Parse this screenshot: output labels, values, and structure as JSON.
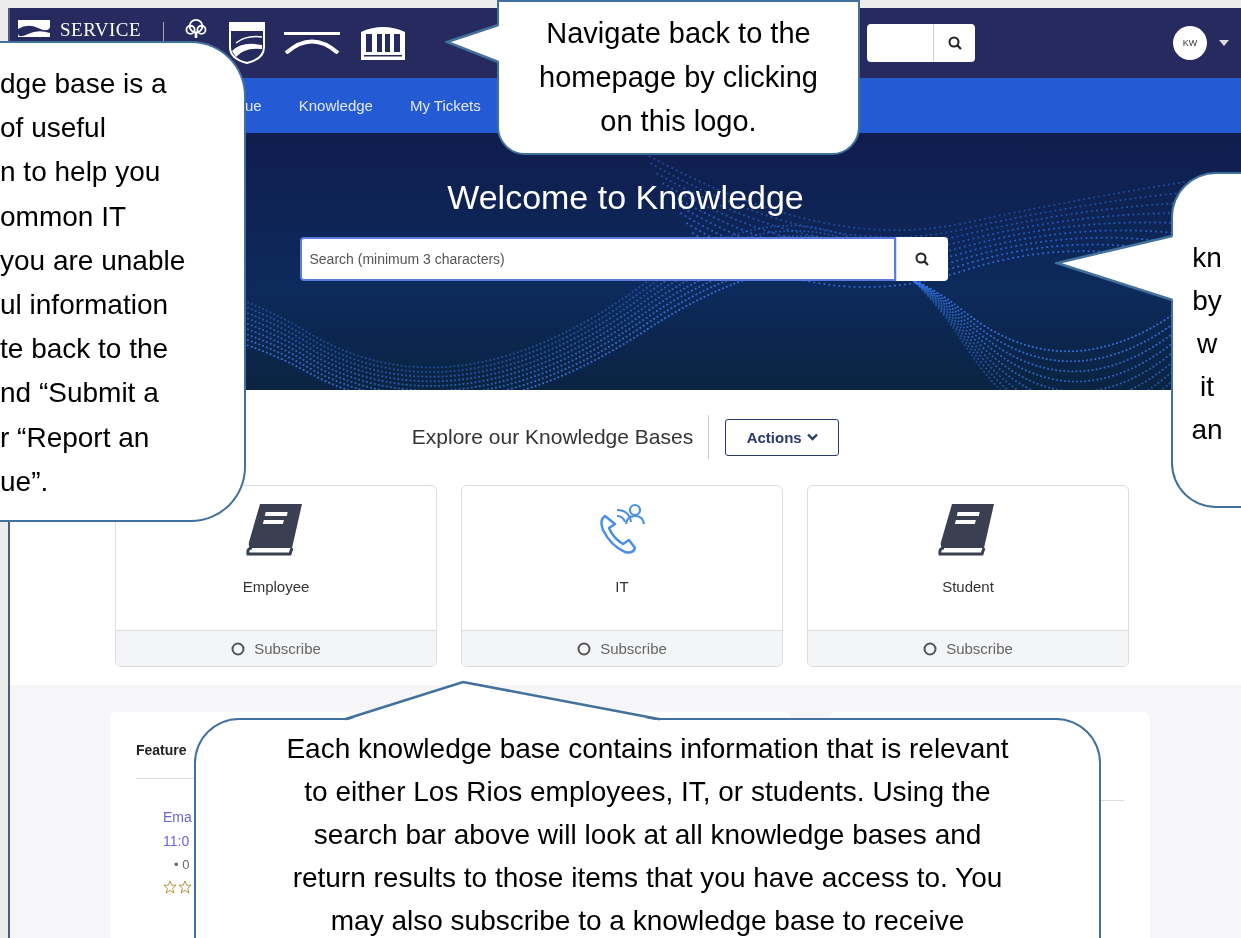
{
  "header": {
    "brand": "SERVICE",
    "avatar": "KW"
  },
  "nav": {
    "items": [
      {
        "label": "ue"
      },
      {
        "label": "Knowledge"
      },
      {
        "label": "My Tickets"
      }
    ]
  },
  "hero": {
    "title": "Welcome to Knowledge",
    "search": {
      "placeholder": "Search (minimum 3 characters)"
    }
  },
  "explore": {
    "title": "Explore our Knowledge Bases",
    "actions": "Actions"
  },
  "knowledge_bases": [
    {
      "name": "Employee",
      "kind": "book",
      "subscribed": false,
      "subscribe_label": "Subscribe"
    },
    {
      "name": "IT",
      "kind": "phone",
      "subscribed": false,
      "subscribe_label": "Subscribe"
    },
    {
      "name": "Student",
      "kind": "book",
      "subscribed": false,
      "subscribe_label": "Subscribe"
    }
  ],
  "featured": {
    "title": "Feature",
    "articles": [
      {
        "title": "Ema",
        "date": "11:0",
        "meta": "• 0"
      }
    ]
  },
  "callouts": [
    {
      "lines": [
        "dge base is a",
        "of useful",
        "n to help you",
        "ommon IT",
        "you are unable",
        "ul information",
        "te back to the",
        "nd “Submit a",
        "r “Report an",
        "ue”."
      ]
    },
    {
      "lines": [
        "Navigate back to the",
        "homepage by clicking",
        "on this logo."
      ]
    },
    {
      "lines": [
        "kn",
        "by",
        "w",
        "it",
        "an"
      ]
    },
    {
      "lines": [
        "Each knowledge base contains information that is relevant",
        "to either Los Rios employees, IT, or students. Using the",
        "search bar above will look at all knowledge bases and",
        "return results to those items that you have access to. You",
        "may also subscribe to a knowledge base to receive"
      ]
    }
  ]
}
